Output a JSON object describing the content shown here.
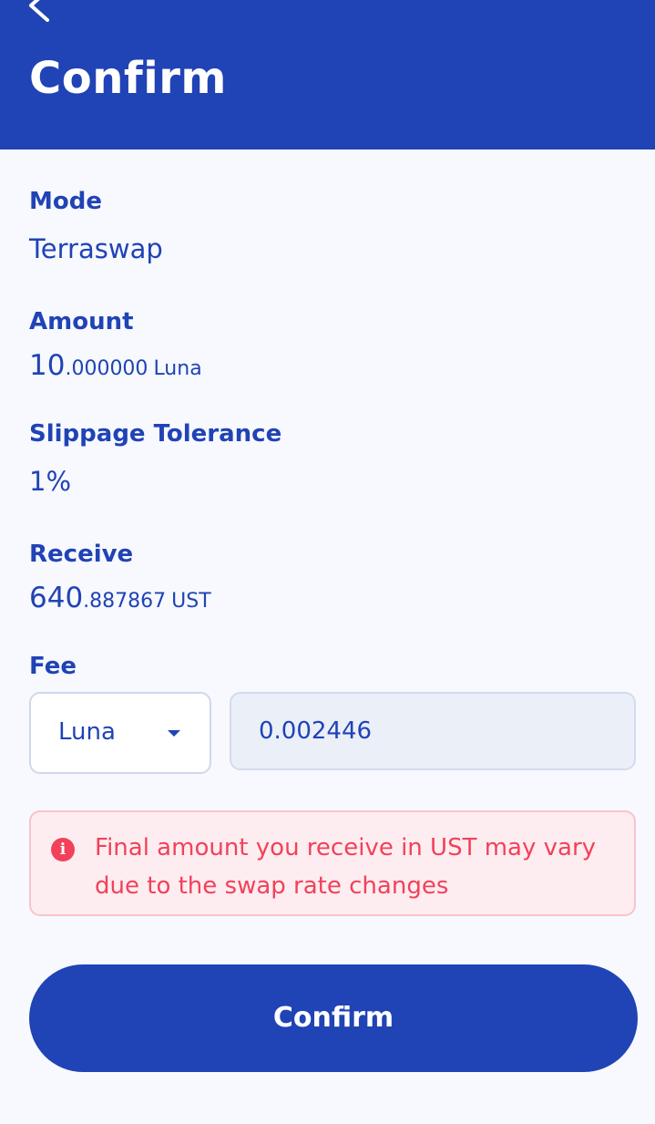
{
  "header": {
    "back_icon": "chevron-left-icon",
    "title": "Confirm"
  },
  "fields": {
    "mode": {
      "label": "Mode",
      "value": "Terraswap"
    },
    "amount": {
      "label": "Amount",
      "integer": "10",
      "decimal": ".000000",
      "unit": "Luna"
    },
    "slippage": {
      "label": "Slippage Tolerance",
      "value": "1%"
    },
    "receive": {
      "label": "Receive",
      "integer": "640",
      "decimal": ".887867",
      "unit": "UST"
    }
  },
  "fee": {
    "label": "Fee",
    "selected_denom": "Luna",
    "amount": "0.002446"
  },
  "warning": {
    "icon": "info-icon",
    "text": "Final amount you receive in UST may vary due to the swap rate changes"
  },
  "actions": {
    "confirm_label": "Confirm"
  },
  "colors": {
    "primary": "#2043b5",
    "background": "#f7f9fe",
    "warning_text": "#f2415a",
    "warning_bg": "#feedf0"
  }
}
